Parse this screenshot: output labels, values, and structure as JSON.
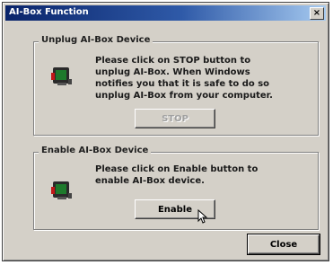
{
  "window": {
    "title": "AI-Box Function",
    "close_glyph": "×"
  },
  "unplug_group": {
    "label": "Unplug AI-Box Device",
    "description_lines": [
      "Please click on STOP button to",
      "unplug AI-Box. When Windows",
      "notifies you that it is safe to do so",
      "unplug AI-Box from your computer."
    ],
    "stop_button_label": "STOP",
    "stop_button_state": "disabled"
  },
  "enable_group": {
    "label": "Enable AI-Box Device",
    "description_lines": [
      "Please click on Enable button to",
      "enable AI-Box device."
    ],
    "enable_button_label": "Enable"
  },
  "close_button_label": "Close",
  "icons": {
    "device": "usb-device-icon",
    "cursor": "mouse-pointer-icon"
  },
  "colors": {
    "title_start": "#0a246a",
    "title_end": "#a6caf0",
    "face": "#d4d0c8",
    "device_screen": "#1e7a2c",
    "device_accent": "#c01818"
  }
}
